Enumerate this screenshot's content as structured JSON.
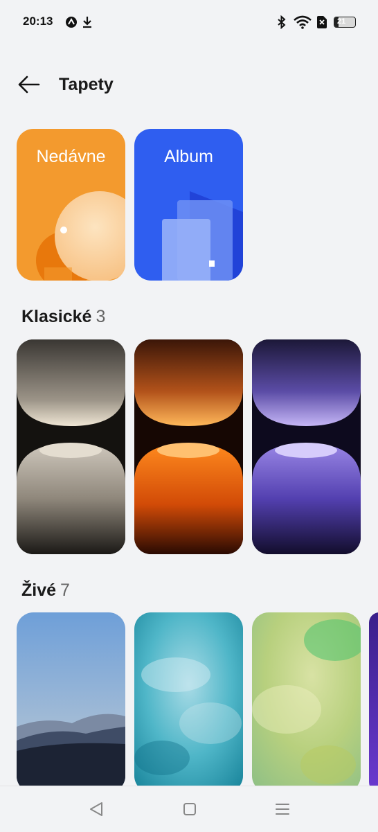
{
  "status_bar": {
    "time": "20:13",
    "battery_level": "21",
    "battery_fraction": 0.21,
    "icons": [
      "gauge-icon",
      "download-icon",
      "bluetooth-icon",
      "wifi-icon",
      "sim-off-icon",
      "battery-icon"
    ]
  },
  "header": {
    "title": "Tapety",
    "back_icon": "arrow-left-icon"
  },
  "albums": [
    {
      "label": "Nedávne",
      "color": "#f39a2e"
    },
    {
      "label": "Album",
      "color": "#2f5ef0"
    }
  ],
  "sections": {
    "classic": {
      "title": "Klasické",
      "count": "3"
    },
    "live": {
      "title": "Živé",
      "count": "7"
    }
  },
  "navigation": {
    "buttons": [
      "back-triangle-icon",
      "home-square-icon",
      "recents-menu-icon"
    ]
  }
}
